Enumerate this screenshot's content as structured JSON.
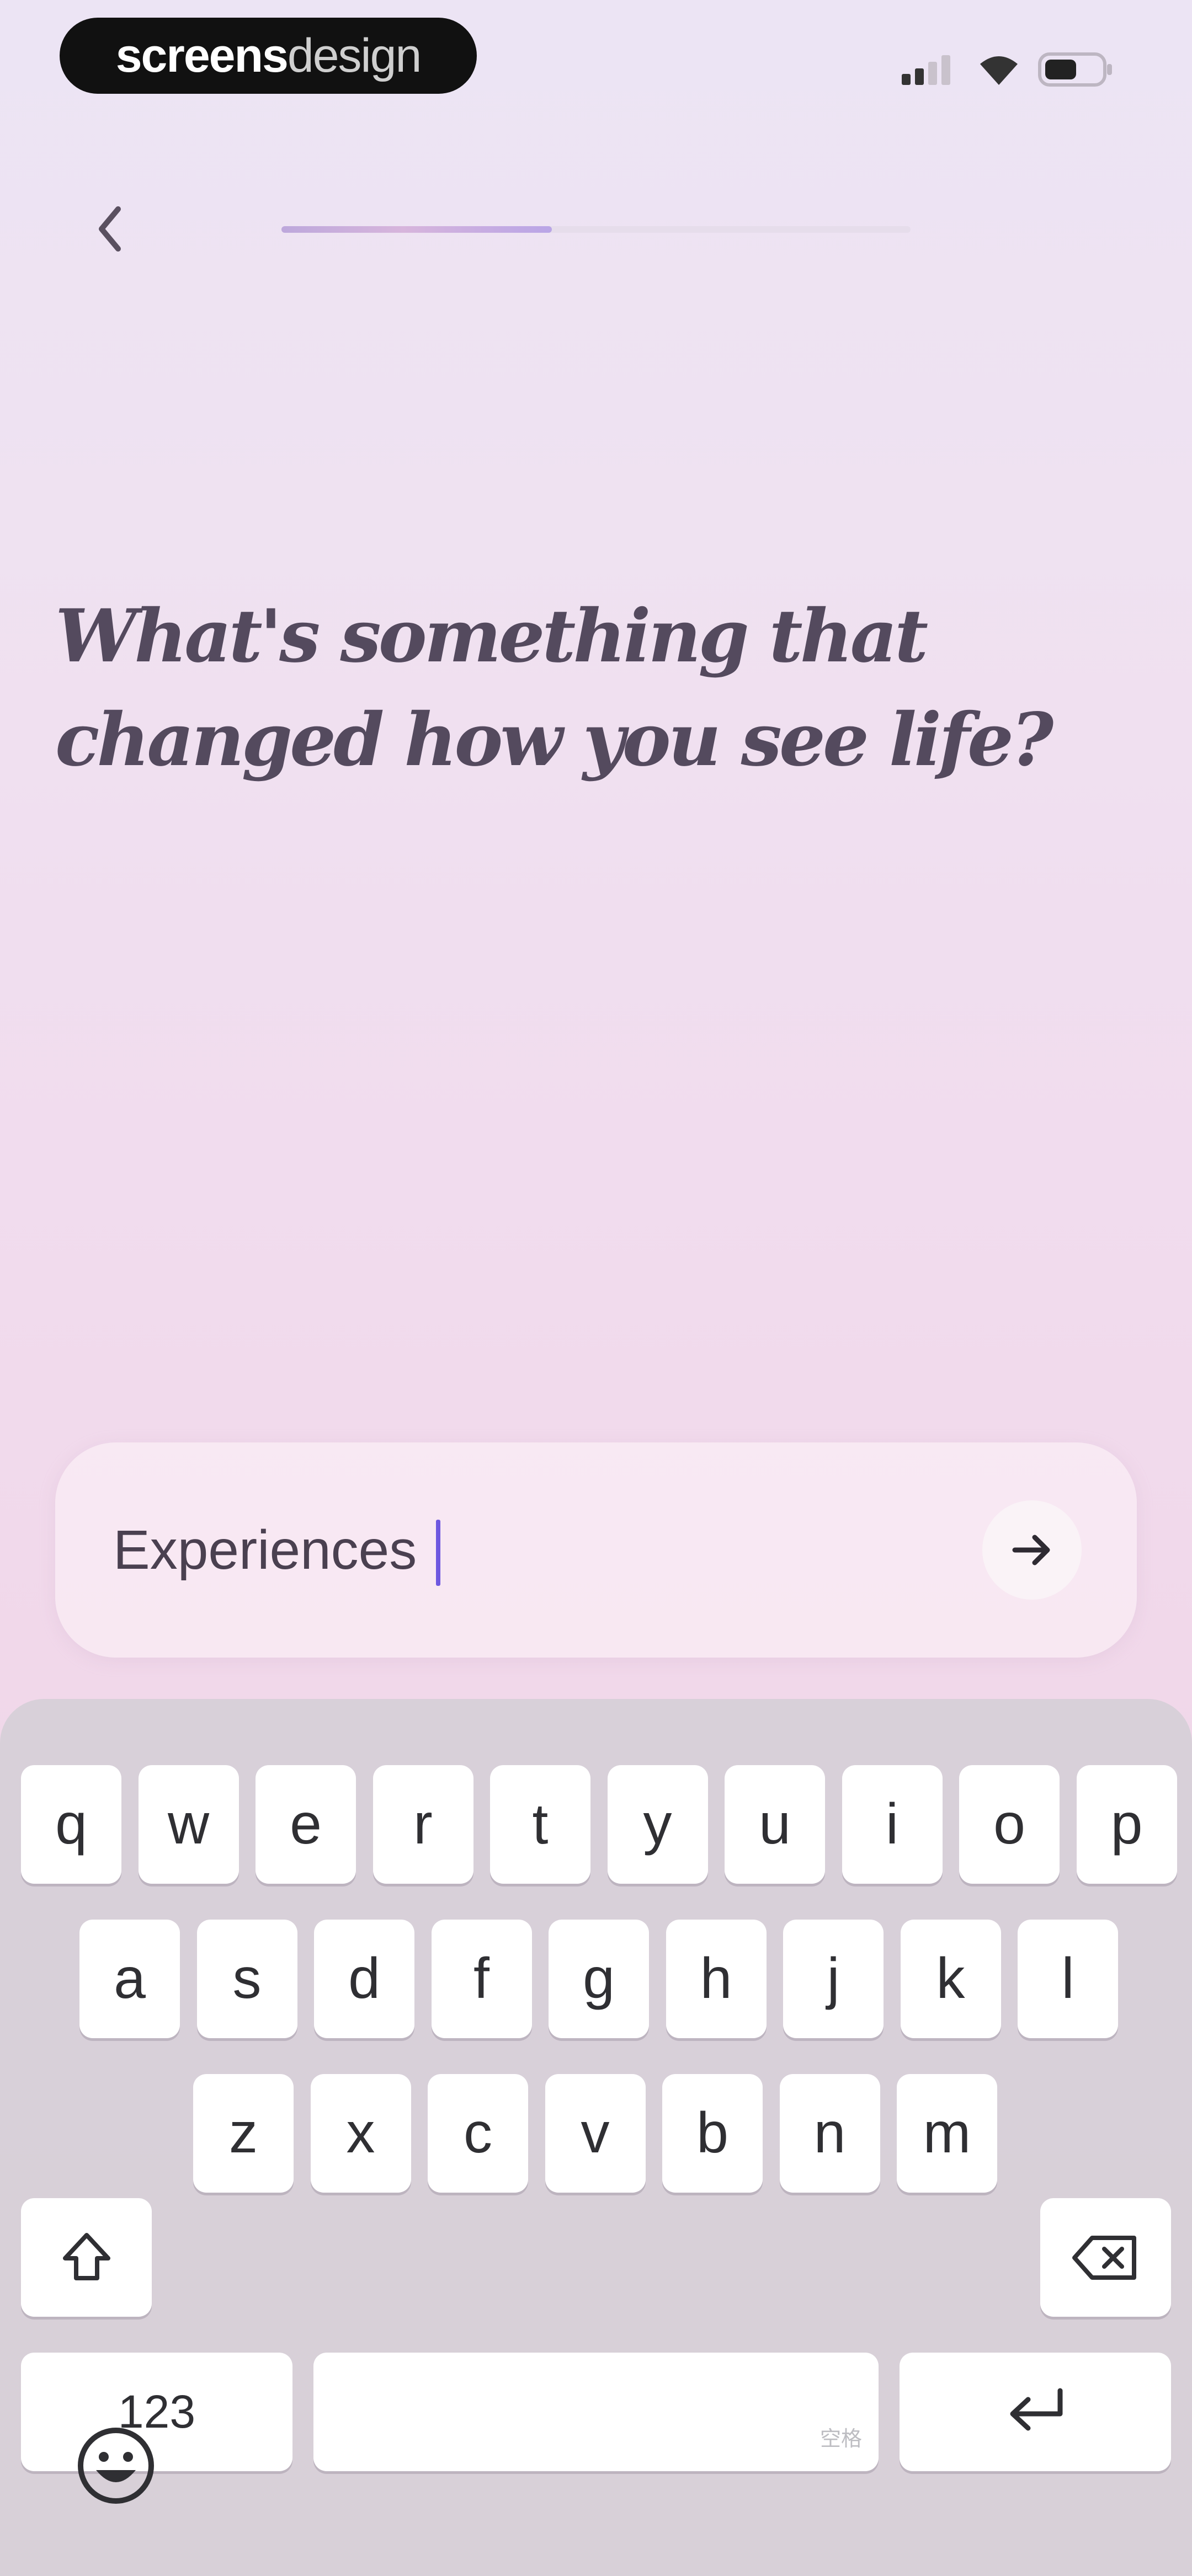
{
  "watermark": {
    "part1": "screens",
    "part2": "design"
  },
  "header": {
    "back_label": "Back",
    "progress": 0.43
  },
  "question": "What's something that changed how you see life?",
  "answer": {
    "value": "Experiences"
  },
  "keyboard": {
    "row1": [
      "q",
      "w",
      "e",
      "r",
      "t",
      "y",
      "u",
      "i",
      "o",
      "p"
    ],
    "row2": [
      "a",
      "s",
      "d",
      "f",
      "g",
      "h",
      "j",
      "k",
      "l"
    ],
    "row3": [
      "z",
      "x",
      "c",
      "v",
      "b",
      "n",
      "m"
    ],
    "numbers_label": "123",
    "space_hint": "空格"
  }
}
